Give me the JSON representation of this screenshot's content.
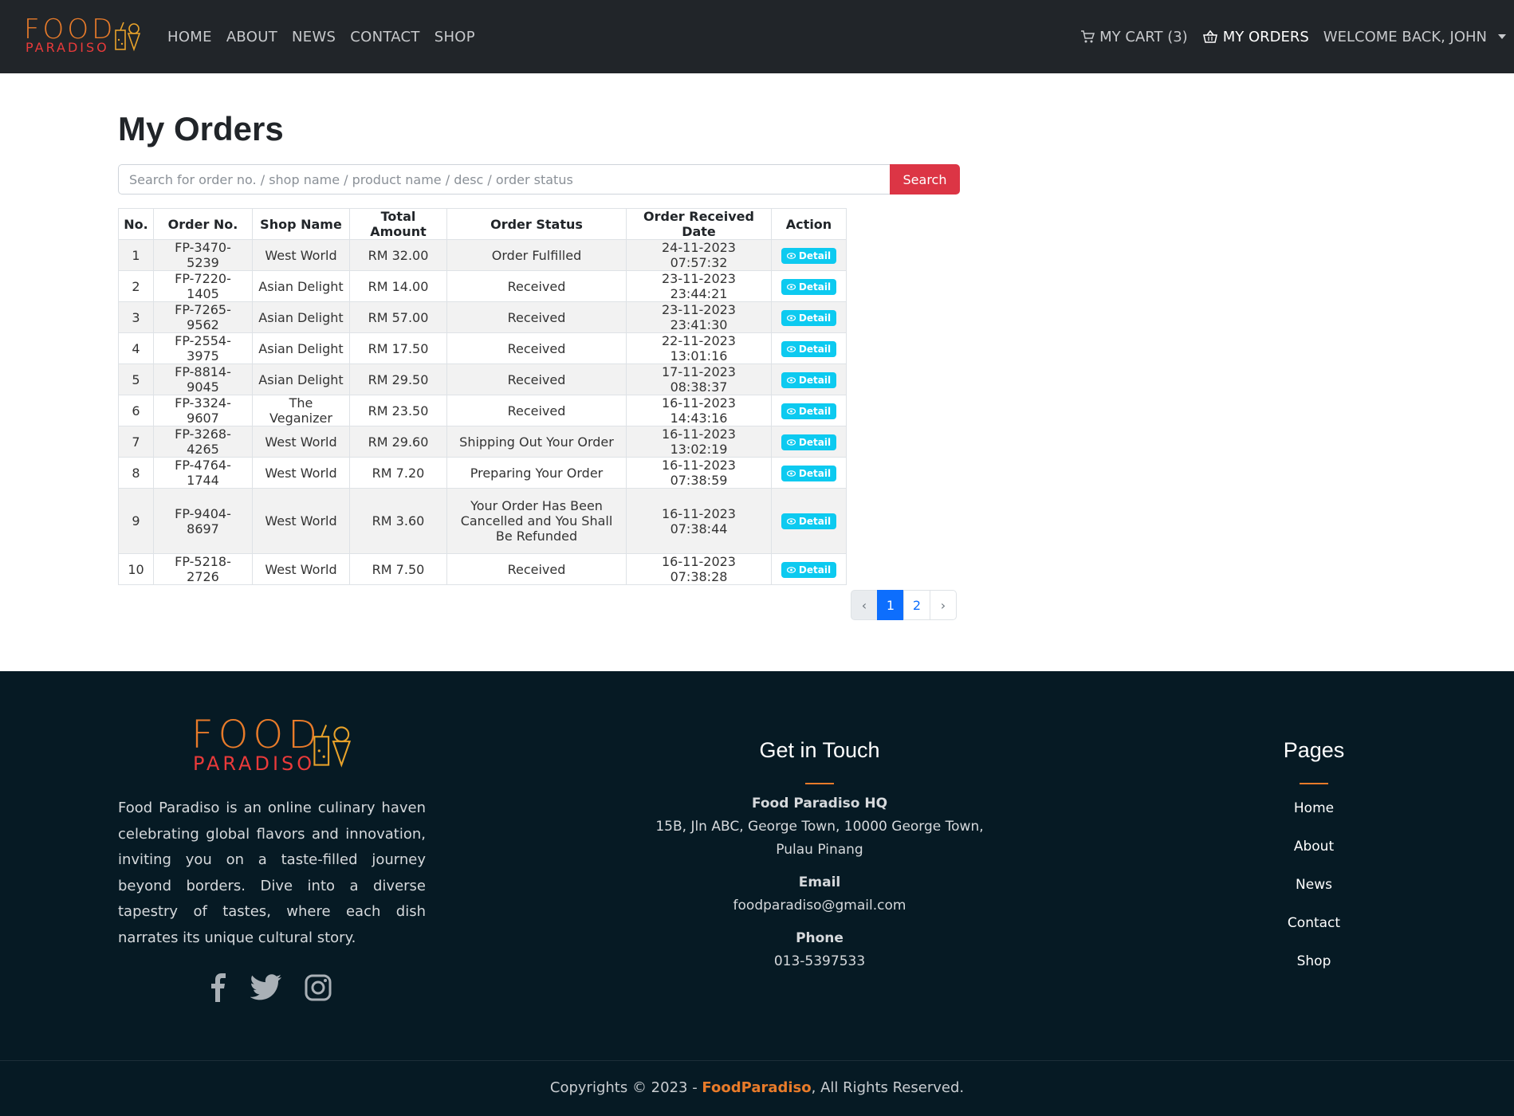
{
  "brand": {
    "logo_top": "FOOD",
    "logo_bottom": "PARADISO"
  },
  "nav": {
    "links": [
      "HOME",
      "ABOUT",
      "NEWS",
      "CONTACT",
      "SHOP"
    ],
    "cart": "MY CART (3)",
    "orders": "MY ORDERS",
    "user": "WELCOME BACK, JOHN"
  },
  "main": {
    "title": "My Orders",
    "search_placeholder": "Search for order no. / shop name / product name / desc / order status",
    "search_button": "Search",
    "columns": [
      "No.",
      "Order No.",
      "Shop Name",
      "Total Amount",
      "Order Status",
      "Order Received Date",
      "Action"
    ],
    "detail_label": "Detail",
    "rows": [
      {
        "no": "1",
        "order": "FP-3470-5239",
        "shop": "West World",
        "amount": "RM 32.00",
        "status": "Order Fulfilled",
        "date": "24-11-2023 07:57:32"
      },
      {
        "no": "2",
        "order": "FP-7220-1405",
        "shop": "Asian Delight",
        "amount": "RM 14.00",
        "status": "Received",
        "date": "23-11-2023 23:44:21"
      },
      {
        "no": "3",
        "order": "FP-7265-9562",
        "shop": "Asian Delight",
        "amount": "RM 57.00",
        "status": "Received",
        "date": "23-11-2023 23:41:30"
      },
      {
        "no": "4",
        "order": "FP-2554-3975",
        "shop": "Asian Delight",
        "amount": "RM 17.50",
        "status": "Received",
        "date": "22-11-2023 13:01:16"
      },
      {
        "no": "5",
        "order": "FP-8814-9045",
        "shop": "Asian Delight",
        "amount": "RM 29.50",
        "status": "Received",
        "date": "17-11-2023 08:38:37"
      },
      {
        "no": "6",
        "order": "FP-3324-9607",
        "shop": "The Veganizer",
        "amount": "RM 23.50",
        "status": "Received",
        "date": "16-11-2023 14:43:16"
      },
      {
        "no": "7",
        "order": "FP-3268-4265",
        "shop": "West World",
        "amount": "RM 29.60",
        "status": "Shipping Out Your Order",
        "date": "16-11-2023 13:02:19"
      },
      {
        "no": "8",
        "order": "FP-4764-1744",
        "shop": "West World",
        "amount": "RM 7.20",
        "status": "Preparing Your Order",
        "date": "16-11-2023 07:38:59"
      },
      {
        "no": "9",
        "order": "FP-9404-8697",
        "shop": "West World",
        "amount": "RM 3.60",
        "status": "Your Order Has Been Cancelled and You Shall Be Refunded",
        "date": "16-11-2023 07:38:44"
      },
      {
        "no": "10",
        "order": "FP-5218-2726",
        "shop": "West World",
        "amount": "RM 7.50",
        "status": "Received",
        "date": "16-11-2023 07:38:28"
      }
    ],
    "pagination": {
      "prev": "‹",
      "pages": [
        "1",
        "2"
      ],
      "current": "1",
      "next": "›"
    }
  },
  "footer": {
    "about": "Food Paradiso is an online culinary haven celebrating global flavors and innovation, inviting you on a taste-filled journey beyond borders. Dive into a diverse tapestry of tastes, where each dish narrates its unique cultural story.",
    "social_icons": [
      "facebook-icon",
      "twitter-icon",
      "instagram-icon"
    ],
    "contact_title": "Get in Touch",
    "hq_label": "Food Paradiso HQ",
    "address": "15B, Jln ABC, George Town, 10000 George Town, Pulau Pinang",
    "email_label": "Email",
    "email": "foodparadiso@gmail.com",
    "phone_label": "Phone",
    "phone": "013-5397533",
    "pages_title": "Pages",
    "pages": [
      "Home",
      "About",
      "News",
      "Contact",
      "Shop"
    ],
    "copyright_prefix": "Copyrights © 2023 - ",
    "copyright_brand": "FoodParadiso",
    "copyright_suffix": ", All Rights Reserved."
  },
  "colors": {
    "accent": "#e87b2a",
    "danger": "#dc3545",
    "info": "#0dcaf0",
    "primary": "#0d6efd",
    "nav_bg": "#212529",
    "footer_bg": "#061a24"
  }
}
